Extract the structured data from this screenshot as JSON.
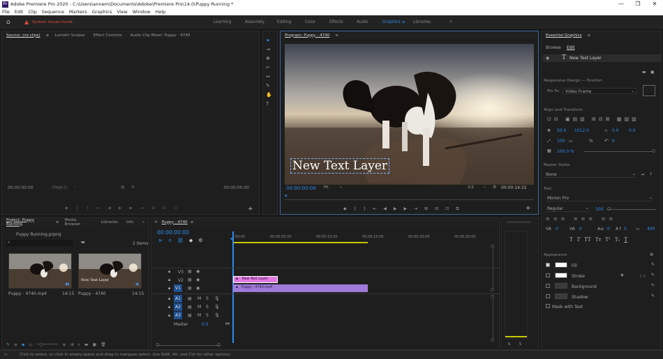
{
  "window": {
    "title": "Adobe Premiere Pro 2020 - C:\\Users\\annem\\Documents\\Adobe\\Premiere Pro\\14.0\\Puppy Running *",
    "min": "—",
    "max": "❐",
    "close": "✕"
  },
  "menu": [
    "File",
    "Edit",
    "Clip",
    "Sequence",
    "Markers",
    "Graphics",
    "View",
    "Window",
    "Help"
  ],
  "workspace": {
    "warning": "System issues found",
    "tabs": [
      "Learning",
      "Assembly",
      "Editing",
      "Color",
      "Effects",
      "Audio",
      "Graphics",
      "Libraries"
    ],
    "active": "Graphics",
    "more": "»"
  },
  "source_panel": {
    "tabs": [
      "Source: (no clips)",
      "Lumetri Scopes",
      "Effect Controls",
      "Audio Clip Mixer: Puppy - 4740"
    ],
    "tc_left": "00:00:00:00",
    "page": "Page 1",
    "tc_right": "00:00:00:00"
  },
  "program_panel": {
    "title": "Program: Puppy - 4740",
    "overlay_text": "New Text Layer",
    "tc_current": "00:00:00:00",
    "fit": "Fit",
    "resolution": "1/2",
    "tc_duration": "00:00:14:15"
  },
  "essential_graphics": {
    "title": "Essential Graphics",
    "tabs": [
      "Browse",
      "Edit"
    ],
    "layer_name": "New Text Layer",
    "responsive_design": "Responsive Design — Position",
    "pin_to_label": "Pin To:",
    "pin_to_value": "Video Frame",
    "align_transform": "Align and Transform",
    "pos_x": "50.0",
    "pos_y": "1012.0",
    "anchor_x": "0.0",
    "anchor_y": "0.0",
    "scale": "100",
    "scale_unit": "%",
    "rotation": "0",
    "opacity": "100.0 %",
    "master_styles": "Master Styles",
    "master_styles_value": "None",
    "text_section": "Text",
    "font": "Minion Pro",
    "font_style": "Regular",
    "font_size": "100",
    "tracking": "0",
    "kerning": "0",
    "leading": "0",
    "baseline": "0",
    "tsume": "400",
    "text_styles": [
      "T",
      "T",
      "TT",
      "Tт",
      "T¹",
      "T₁",
      "T"
    ],
    "appearance": "Appearance",
    "fill": "Fill",
    "stroke": "Stroke",
    "stroke_width": "1.0",
    "background": "Background",
    "shadow": "Shadow",
    "mask_with_text": "Mask with Text",
    "colors": {
      "fill": "#ffffff",
      "stroke": "#ffffff",
      "background": "#3a3a3a",
      "shadow": "#3a3a3a"
    }
  },
  "project_panel": {
    "tabs": [
      "Project: Puppy Running",
      "Media Browser",
      "Libraries",
      "Info"
    ],
    "more": "»",
    "file": "Puppy Running.prproj",
    "items_count": "2 items",
    "items": [
      {
        "name": "Puppy - 4740.mp4",
        "duration": "14:15"
      },
      {
        "name": "Puppy - 4740",
        "duration": "14:15",
        "label": "New Text Layer"
      }
    ]
  },
  "timeline": {
    "title": "Puppy - 4740",
    "timecode": "00:00:00:00",
    "ruler": [
      ":00:00",
      "00:00:05:00",
      "00:00:10:00",
      "00:00:15:00",
      "00:00:20:00",
      "00:00:25:00"
    ],
    "tracks": [
      {
        "id": "V3",
        "type": "video"
      },
      {
        "id": "V2",
        "type": "video"
      },
      {
        "id": "V1",
        "type": "video"
      },
      {
        "id": "A1",
        "type": "audio"
      },
      {
        "id": "A2",
        "type": "audio"
      },
      {
        "id": "A3",
        "type": "audio"
      }
    ],
    "master_label": "Master",
    "master_value": "0.0",
    "clips": [
      {
        "track": "V2",
        "label": "New Text Layer"
      },
      {
        "track": "V1",
        "label": "Puppy - 4740.mp4"
      }
    ]
  },
  "audio_meter": {
    "labels": [
      "S",
      "S"
    ]
  },
  "status": "Click to select, or click in empty space and drag to marquee select. Use Shift, Alt, and Ctrl for other options."
}
